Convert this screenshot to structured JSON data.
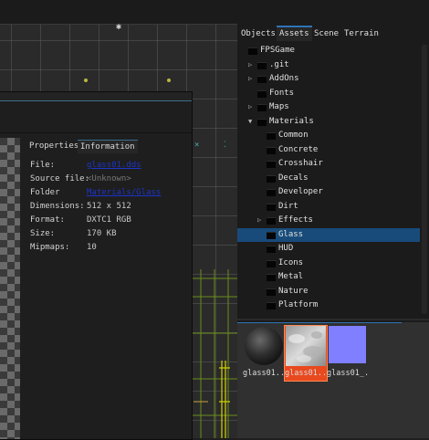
{
  "info_panel": {
    "tabs": [
      "Properties",
      "Information"
    ],
    "active_tab": "Information",
    "rows": [
      {
        "label": "File:",
        "value": "glass01.dds",
        "style": "link"
      },
      {
        "label": "Source file:",
        "value": "<Unknown>",
        "style": "dim"
      },
      {
        "label": "Folder",
        "value": "Materials/Glass",
        "style": "link"
      },
      {
        "label": "Dimensions:",
        "value": "512 x 512",
        "style": "plain"
      },
      {
        "label": "Format:",
        "value": "DXTC1 RGB",
        "style": "plain"
      },
      {
        "label": "Size:",
        "value": "170 KB",
        "style": "plain"
      },
      {
        "label": "Mipmaps:",
        "value": "10",
        "style": "plain"
      }
    ]
  },
  "right_panel": {
    "tabs": [
      "Objects",
      "Assets",
      "Scene",
      "Terrain"
    ],
    "active_tab": "Assets",
    "tree": [
      {
        "label": "FPSGame",
        "depth": 0,
        "arrow": "expanded-none"
      },
      {
        "label": ".git",
        "depth": 1,
        "arrow": "collapsed"
      },
      {
        "label": "AddOns",
        "depth": 1,
        "arrow": "collapsed"
      },
      {
        "label": "Fonts",
        "depth": 1,
        "arrow": "none"
      },
      {
        "label": "Maps",
        "depth": 1,
        "arrow": "collapsed"
      },
      {
        "label": "Materials",
        "depth": 1,
        "arrow": "expanded"
      },
      {
        "label": "Common",
        "depth": 2,
        "arrow": "none"
      },
      {
        "label": "Concrete",
        "depth": 2,
        "arrow": "none"
      },
      {
        "label": "Crosshair",
        "depth": 2,
        "arrow": "none"
      },
      {
        "label": "Decals",
        "depth": 2,
        "arrow": "none"
      },
      {
        "label": "Developer",
        "depth": 2,
        "arrow": "none"
      },
      {
        "label": "Dirt",
        "depth": 2,
        "arrow": "none"
      },
      {
        "label": "Effects",
        "depth": 2,
        "arrow": "collapsed"
      },
      {
        "label": "Glass",
        "depth": 2,
        "arrow": "none",
        "selected": true
      },
      {
        "label": "HUD",
        "depth": 2,
        "arrow": "none"
      },
      {
        "label": "Icons",
        "depth": 2,
        "arrow": "none"
      },
      {
        "label": "Metal",
        "depth": 2,
        "arrow": "none"
      },
      {
        "label": "Nature",
        "depth": 2,
        "arrow": "none"
      },
      {
        "label": "Platform",
        "depth": 2,
        "arrow": "none"
      }
    ],
    "thumbnails": [
      {
        "label": "glass01...",
        "kind": "sphere-icon"
      },
      {
        "label": "glass01...",
        "kind": "glass-texture-icon",
        "selected": true
      },
      {
        "label": "glass01_...",
        "kind": "normalmap-texture-icon"
      }
    ]
  },
  "colors": {
    "accent": "#2e74b5",
    "selection": "#184b7a",
    "thumb_selection": "#e8491e",
    "link": "#1c34c8",
    "normal_map": "#7f7fff"
  }
}
